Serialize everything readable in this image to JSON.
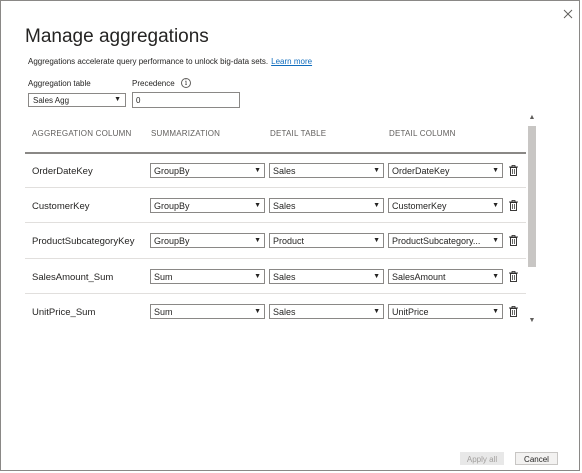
{
  "dialog": {
    "title": "Manage aggregations",
    "description": "Aggregations accelerate query performance to unlock big-data sets.",
    "learn_more": "Learn more",
    "close_icon": "close-icon"
  },
  "aggregation_table": {
    "label": "Aggregation table",
    "value": "Sales Agg"
  },
  "precedence": {
    "label": "Precedence",
    "value": "0",
    "info_icon": "info-icon"
  },
  "table": {
    "headers": [
      "AGGREGATION COLUMN",
      "SUMMARIZATION",
      "DETAIL TABLE",
      "DETAIL COLUMN"
    ],
    "rows": [
      {
        "column": "OrderDateKey",
        "summarization": "GroupBy",
        "detail_table": "Sales",
        "detail_column": "OrderDateKey"
      },
      {
        "column": "CustomerKey",
        "summarization": "GroupBy",
        "detail_table": "Sales",
        "detail_column": "CustomerKey"
      },
      {
        "column": "ProductSubcategoryKey",
        "summarization": "GroupBy",
        "detail_table": "Product",
        "detail_column": "ProductSubcategory..."
      },
      {
        "column": "SalesAmount_Sum",
        "summarization": "Sum",
        "detail_table": "Sales",
        "detail_column": "SalesAmount"
      },
      {
        "column": "UnitPrice_Sum",
        "summarization": "Sum",
        "detail_table": "Sales",
        "detail_column": "UnitPrice"
      }
    ]
  },
  "footer": {
    "apply_all": "Apply all",
    "cancel": "Cancel"
  },
  "colors": {
    "link": "#0f6cbd",
    "border": "#8a8886",
    "scrollbar": "#c8c6c4"
  }
}
